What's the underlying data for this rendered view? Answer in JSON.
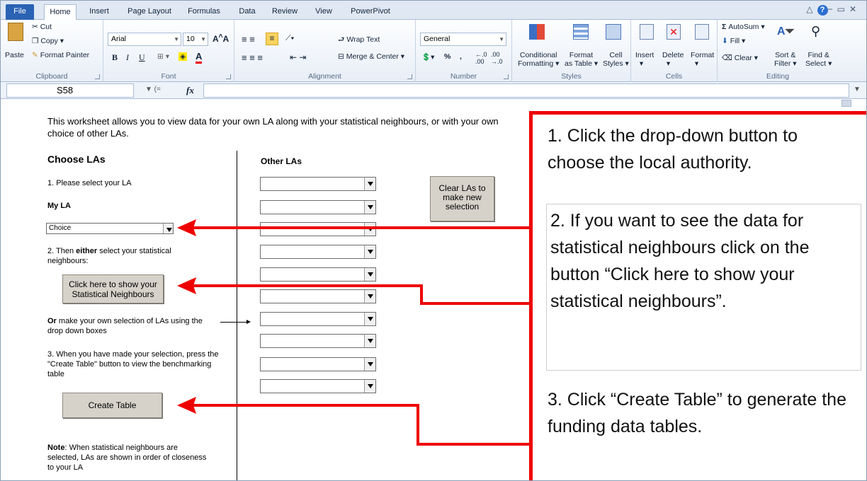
{
  "tabs": [
    "File",
    "Home",
    "Insert",
    "Page Layout",
    "Formulas",
    "Data",
    "Review",
    "View",
    "PowerPivot"
  ],
  "window": {
    "controls": "△ ? − ▭ ✕"
  },
  "ribbon": {
    "clipboard": {
      "paste": "Paste",
      "cut": "Cut",
      "copy": "Copy",
      "format_painter": "Format Painter",
      "label": "Clipboard"
    },
    "font": {
      "name": "Arial",
      "size": "10",
      "label": "Font"
    },
    "alignment": {
      "wrap_text": "Wrap Text",
      "merge_center": "Merge & Center",
      "label": "Alignment"
    },
    "number": {
      "format": "General",
      "label": "Number"
    },
    "styles": {
      "conditional": "Conditional",
      "conditional2": "Formatting",
      "format_table": "Format",
      "format_table2": "as Table",
      "cell_styles": "Cell",
      "cell_styles2": "Styles",
      "label": "Styles"
    },
    "cells": {
      "insert": "Insert",
      "delete": "Delete",
      "format": "Format",
      "label": "Cells"
    },
    "editing": {
      "autosum": "AutoSum",
      "fill": "Fill",
      "clear": "Clear",
      "sort": "Sort &",
      "sort2": "Filter",
      "find": "Find &",
      "find2": "Select",
      "label": "Editing"
    }
  },
  "formula_bar": {
    "name_box": "S58",
    "fx": "fx",
    "value": ""
  },
  "sheet": {
    "intro": "This worksheet allows you to view data for your own LA along with your statistical neighbours, or with your own choice of other LAs.",
    "choose_las": "Choose LAs",
    "other_las": "Other LAs",
    "step1": "1. Please select your LA",
    "my_la": "My LA",
    "my_la_value": "Choice",
    "step2_pre": "2. Then ",
    "step2_either": "either",
    "step2_post": " select your statistical neighbours:",
    "stat_button": "Click here to show your Statistical Neighbours",
    "or_word": "Or",
    "or_text": " make your own selection of LAs using the drop down boxes",
    "step3": "3. When you have made your selection, press the \"Create Table\" button to view the benchmarking table",
    "create_table": "Create Table",
    "note_word": "Note",
    "note_text": ": When statistical neighbours are selected, LAs are shown in order of closeness to your LA",
    "clear_button": "Clear LAs to make new selection"
  },
  "annotations": {
    "a1": "1. Click the drop-down button to choose the local authority.",
    "a2": "2. If you want to see the data for statistical neighbours click on the button “Click here to show your statistical neighbours”.",
    "a3": "3. Click “Create Table” to generate the funding data tables."
  },
  "colors": {
    "arrow": "#e00000",
    "file_tab": "#2a62b4"
  }
}
